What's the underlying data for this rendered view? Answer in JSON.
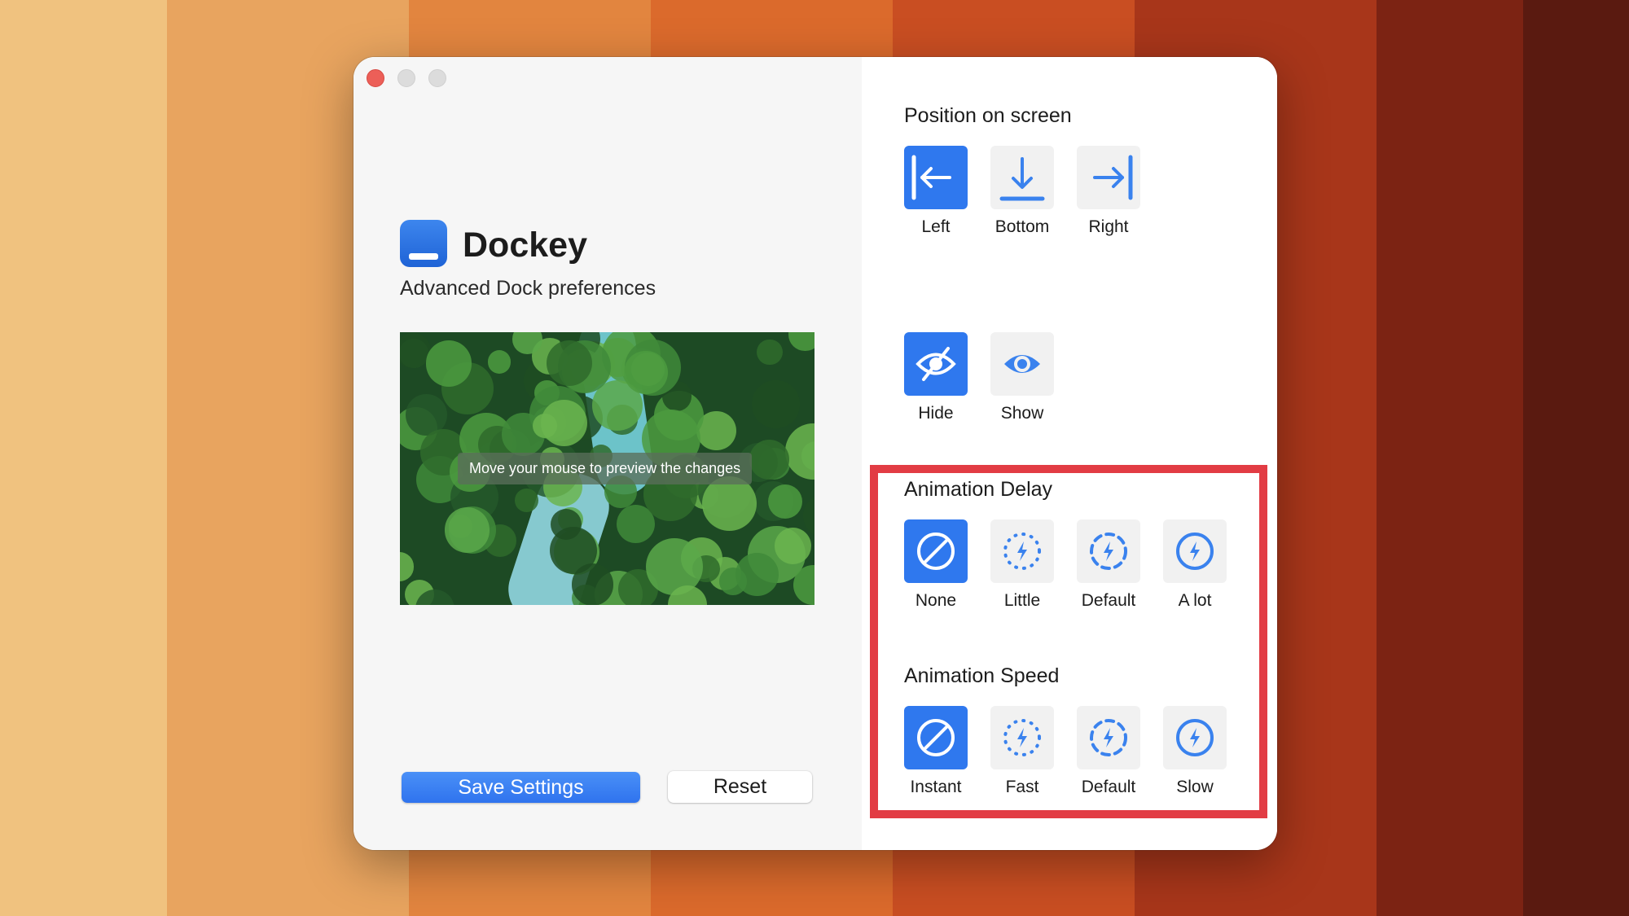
{
  "app": {
    "name": "Dockey",
    "subtitle": "Advanced Dock preferences",
    "preview_caption": "Move your mouse to preview the changes"
  },
  "buttons": {
    "save": "Save Settings",
    "reset": "Reset"
  },
  "position": {
    "title": "Position on screen",
    "options": [
      {
        "label": "Left",
        "icon": "arrow-left-to-bar-icon",
        "selected": true
      },
      {
        "label": "Bottom",
        "icon": "arrow-down-to-bar-icon",
        "selected": false
      },
      {
        "label": "Right",
        "icon": "arrow-right-to-bar-icon",
        "selected": false
      }
    ]
  },
  "visibility": {
    "options": [
      {
        "label": "Hide",
        "icon": "eye-slash-icon",
        "selected": true
      },
      {
        "label": "Show",
        "icon": "eye-icon",
        "selected": false
      }
    ]
  },
  "animation_delay": {
    "title": "Animation Delay",
    "options": [
      {
        "label": "None",
        "icon": "disabled-circle-icon",
        "selected": true
      },
      {
        "label": "Little",
        "icon": "bolt-dotted-circle-icon",
        "selected": false
      },
      {
        "label": "Default",
        "icon": "bolt-dashed-circle-icon",
        "selected": false
      },
      {
        "label": "A lot",
        "icon": "bolt-circle-icon",
        "selected": false
      }
    ]
  },
  "animation_speed": {
    "title": "Animation Speed",
    "options": [
      {
        "label": "Instant",
        "icon": "disabled-circle-icon",
        "selected": true
      },
      {
        "label": "Fast",
        "icon": "bolt-dotted-circle-icon",
        "selected": false
      },
      {
        "label": "Default",
        "icon": "bolt-dashed-circle-icon",
        "selected": false
      },
      {
        "label": "Slow",
        "icon": "bolt-circle-icon",
        "selected": false
      }
    ]
  },
  "colors": {
    "accent": "#2f78ee",
    "highlight": "#e23c44",
    "background_stripes": [
      "#f0c27f",
      "#e8a45f",
      "#e2853f",
      "#db6a2c",
      "#c94e22",
      "#a8361a",
      "#7c2313",
      "#5a1a10"
    ]
  }
}
